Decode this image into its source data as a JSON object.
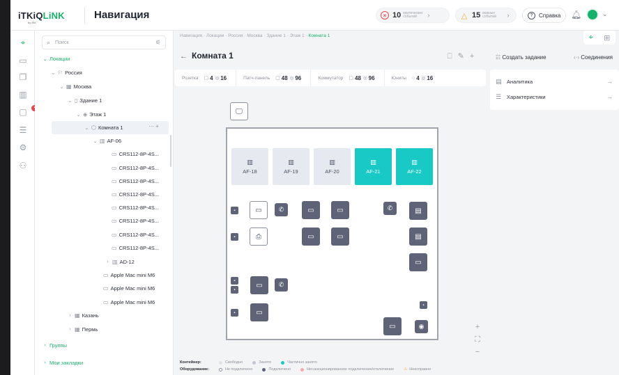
{
  "app": {
    "logo_main": "iTKiQ",
    "logo_accent": "LiNK",
    "logo_sub": "by IEK",
    "title": "Навигация"
  },
  "alerts": [
    {
      "count": "10",
      "label": "критических событий",
      "color": "#e5484d"
    },
    {
      "count": "15",
      "label": "важных событий",
      "color": "#f5a623"
    }
  ],
  "header": {
    "help_label": "Справка"
  },
  "search": {
    "placeholder": "Поиск"
  },
  "tree": {
    "locations": "Локации",
    "russia": "Россия",
    "moscow": "Москва",
    "building": "Здание 1",
    "floor": "Этаж 1",
    "room": "Комната 1",
    "rack": "AF-06",
    "switches": [
      "CRS112-8P-4S...",
      "CRS112-8P-4S...",
      "CRS112-8P-4S...",
      "CRS112-8P-4S...",
      "CRS112-8P-4S...",
      "CRS112-8P-4S...",
      "CRS112-8P-4S...",
      "CRS112-8P-4S..."
    ],
    "rack2": "AD-12",
    "macs": [
      "Apple Mac mini M6",
      "Apple Mac mini M6",
      "Apple Mac mini M6"
    ],
    "kazan": "Казань",
    "perm": "Пермь",
    "groups": "Группы",
    "bookmarks": "Мои закладки"
  },
  "breadcrumb": {
    "items": [
      "Навигация",
      "Локации",
      "Россия",
      "Москва",
      "Здание 1",
      "Этаж 1"
    ],
    "current": "Комната 1",
    "separator": "·"
  },
  "room": {
    "title": "Комната 1"
  },
  "stats": [
    {
      "label": "Розетка",
      "v1": "4",
      "v2": "16"
    },
    {
      "label": "Патч-панель",
      "v1": "48",
      "v2": "96"
    },
    {
      "label": "Коммутатор",
      "v1": "48",
      "v2": "96"
    },
    {
      "label": "Юниты",
      "v1": "4",
      "v2": "16"
    }
  ],
  "right_panel": {
    "create_task": "Создать задание",
    "connections": "Соединения",
    "analytics": "Аналитика",
    "characteristics": "Характеристики"
  },
  "racks": [
    {
      "label": "AF-18",
      "state": "free"
    },
    {
      "label": "AF-19",
      "state": "free"
    },
    {
      "label": "AF-20",
      "state": "free"
    },
    {
      "label": "AF-21",
      "state": "partial"
    },
    {
      "label": "AF-22",
      "state": "partial"
    }
  ],
  "legend": {
    "container_title": "Контейнер:",
    "container_items": [
      {
        "label": "Свободно",
        "color": "#e2e4ea"
      },
      {
        "label": "Занято",
        "color": "#c4c7cf"
      },
      {
        "label": "Частично занято",
        "color": "#18c9c5"
      }
    ],
    "equipment_title": "Оборудование:",
    "equipment_items": [
      {
        "label": "Не подключено",
        "color": "#ffffff",
        "border": "#8b9099"
      },
      {
        "label": "Подключено",
        "color": "#5e6377"
      },
      {
        "label": "Несанкционированное подключение/отключение",
        "color": "#f7a8aa"
      },
      {
        "label": "Неисправно",
        "color": "#f5a623"
      }
    ]
  },
  "colors": {
    "accent": "#17b26a",
    "teal": "#18c9c5",
    "device": "#5e6377"
  }
}
